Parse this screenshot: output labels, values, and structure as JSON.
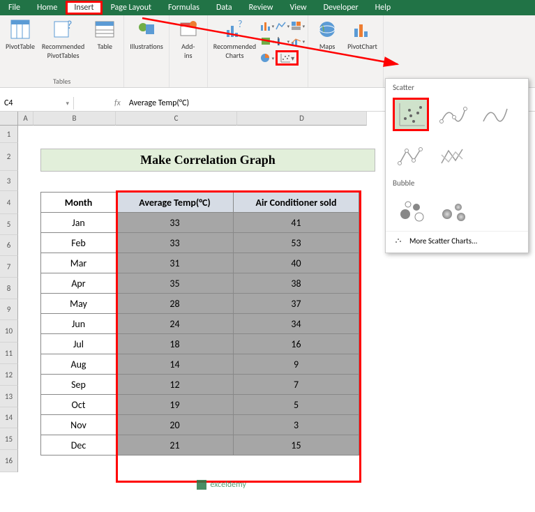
{
  "tabs": {
    "file": "File",
    "home": "Home",
    "insert": "Insert",
    "pagelayout": "Page Layout",
    "formulas": "Formulas",
    "data": "Data",
    "review": "Review",
    "view": "View",
    "developer": "Developer",
    "help": "Help"
  },
  "ribbon": {
    "pivottable": "PivotTable",
    "recpivot": "Recommended\nPivotTables",
    "table": "Table",
    "tables_lbl": "Tables",
    "illustrations": "Illustrations",
    "addins": "Add-\nins",
    "reccharts": "Recommended\nCharts",
    "maps": "Maps",
    "pivotchart": "PivotChart"
  },
  "namebox": "C4",
  "formula": "Average Temp(°C)",
  "colheads": [
    "A",
    "B",
    "C",
    "D"
  ],
  "rownums": [
    "1",
    "2",
    "3",
    "4",
    "5",
    "6",
    "7",
    "8",
    "9",
    "10",
    "11",
    "12",
    "13",
    "14",
    "15",
    "16"
  ],
  "title": "Make Correlation Graph",
  "headers": {
    "month": "Month",
    "temp": "Average Temp(°C)",
    "ac": "Air Conditioner sold"
  },
  "rows": [
    {
      "m": "Jan",
      "t": "33",
      "a": "41"
    },
    {
      "m": "Feb",
      "t": "33",
      "a": "53"
    },
    {
      "m": "Mar",
      "t": "31",
      "a": "40"
    },
    {
      "m": "Apr",
      "t": "35",
      "a": "38"
    },
    {
      "m": "May",
      "t": "28",
      "a": "37"
    },
    {
      "m": "Jun",
      "t": "24",
      "a": "34"
    },
    {
      "m": "Jul",
      "t": "18",
      "a": "16"
    },
    {
      "m": "Aug",
      "t": "14",
      "a": "9"
    },
    {
      "m": "Sep",
      "t": "12",
      "a": "7"
    },
    {
      "m": "Oct",
      "t": "19",
      "a": "5"
    },
    {
      "m": "Nov",
      "t": "20",
      "a": "3"
    },
    {
      "m": "Dec",
      "t": "21",
      "a": "15"
    }
  ],
  "popup": {
    "scatter": "Scatter",
    "bubble": "Bubble",
    "more": "More Scatter Charts..."
  },
  "watermark": "exceldemy"
}
